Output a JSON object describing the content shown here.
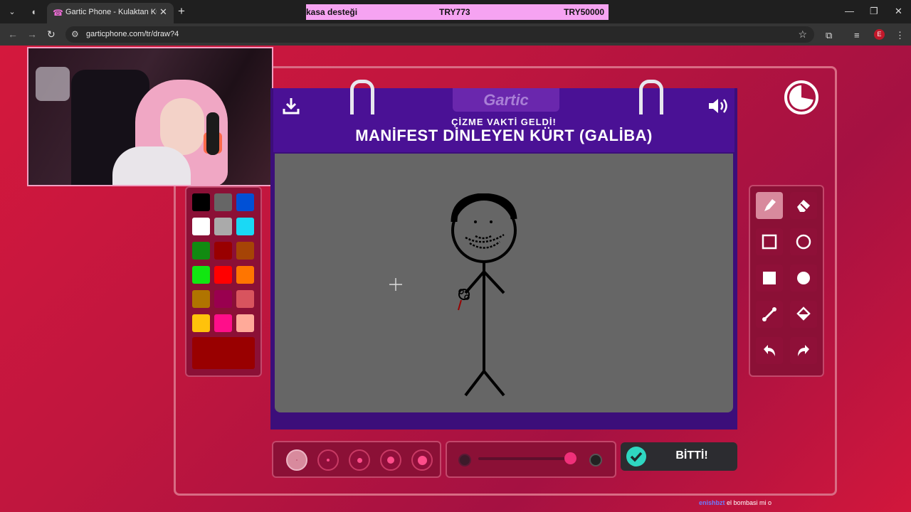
{
  "browser": {
    "tab_title": "Gartic Phone - Kulaktan Kulağa",
    "url": "garticphone.com/tr/draw?4",
    "new_tab": "+",
    "close_tab": "✕",
    "profile_letter": "E"
  },
  "donation_bar": {
    "label": "kasa desteği",
    "current": "TRY773",
    "goal": "TRY50000"
  },
  "game": {
    "logo": "Gartic",
    "subtitle": "ÇİZME VAKTİ GELDİ!",
    "prompt": "MANİFEST DİNLEYEN KÜRT (GALİBA)",
    "done_label": "BİTTİ!",
    "timer_elapsed_fraction": 0.28
  },
  "palette": {
    "colors": [
      "#000000",
      "#666666",
      "#0050d6",
      "#ffffff",
      "#aaaaaa",
      "#1ad9f5",
      "#118a11",
      "#990000",
      "#a64406",
      "#11e611",
      "#ff0000",
      "#ff7500",
      "#b07400",
      "#99004f",
      "#d8545e",
      "#ffc20b",
      "#ff0e8a",
      "#ffaa99"
    ],
    "selected_color": "#990000"
  },
  "tools": [
    "pencil-icon",
    "eraser-icon",
    "square-outline-icon",
    "circle-outline-icon",
    "square-filled-icon",
    "circle-filled-icon",
    "line-icon",
    "fill-bucket-icon",
    "undo-icon",
    "redo-icon"
  ],
  "active_tool": "pencil-icon",
  "brush_sizes": 5,
  "opacity_level": 0.95,
  "chat": {
    "user": "enishbzt",
    "message": "el bombasi mi o"
  }
}
